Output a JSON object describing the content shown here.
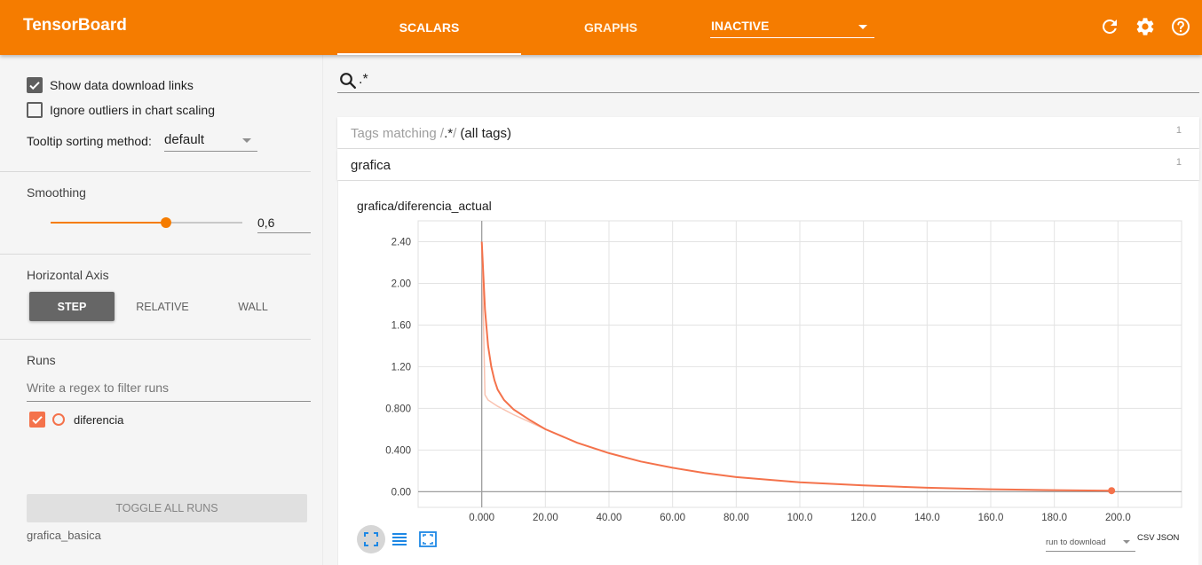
{
  "app": {
    "title": "TensorBoard"
  },
  "header": {
    "tabs": [
      {
        "label": "SCALARS",
        "active": true
      },
      {
        "label": "GRAPHS",
        "active": false
      }
    ],
    "inactive_select": "INACTIVE",
    "icons": [
      "refresh-icon",
      "settings-icon",
      "help-icon"
    ]
  },
  "sidebar": {
    "show_download_links": {
      "label": "Show data download links",
      "checked": true
    },
    "ignore_outliers": {
      "label": "Ignore outliers in chart scaling",
      "checked": false
    },
    "tooltip_sorting": {
      "label": "Tooltip sorting method:",
      "value": "default"
    },
    "smoothing": {
      "title": "Smoothing",
      "value": 0.6,
      "display": "0,6"
    },
    "horizontal_axis": {
      "title": "Horizontal Axis",
      "options": [
        "STEP",
        "RELATIVE",
        "WALL"
      ],
      "selected": "STEP"
    },
    "runs": {
      "title": "Runs",
      "filter_placeholder": "Write a regex to filter runs",
      "items": [
        {
          "name": "diferencia",
          "checked": true,
          "color": "#f4724b"
        }
      ]
    },
    "toggle_all_runs": "TOGGLE ALL RUNS",
    "logdir": "grafica_basica"
  },
  "main": {
    "search": {
      "value": ".*"
    },
    "tags_bar": {
      "prefix": "Tags matching /",
      "regex": ".*",
      "suffix": "/",
      "all_tags": "(all tags)",
      "count": "1"
    },
    "category": {
      "name": "grafica",
      "count": "1"
    },
    "card": {
      "title": "grafica/diferencia_actual",
      "download": {
        "select": "run to download",
        "csv": "CSV",
        "json": "JSON"
      }
    }
  },
  "colors": {
    "accent": "#f57c00",
    "series": "#f4724b",
    "series_raw": "#f9c3b1"
  },
  "chart_data": {
    "type": "line",
    "title": "grafica/diferencia_actual",
    "xlabel": "",
    "ylabel": "",
    "xlim": [
      -20,
      220
    ],
    "ylim": [
      -0.15,
      2.6
    ],
    "x_ticks": [
      "0.000",
      "20.00",
      "40.00",
      "60.00",
      "80.00",
      "100.0",
      "120.0",
      "140.0",
      "160.0",
      "180.0",
      "200.0"
    ],
    "y_ticks": [
      "0.00",
      "0.400",
      "0.800",
      "1.20",
      "1.60",
      "2.00",
      "2.40"
    ],
    "x_tick_values": [
      0,
      20,
      40,
      60,
      80,
      100,
      120,
      140,
      160,
      180,
      200
    ],
    "y_tick_values": [
      0,
      0.4,
      0.8,
      1.2,
      1.6,
      2.0,
      2.4
    ],
    "grid": true,
    "series": [
      {
        "name": "diferencia",
        "smoothed": [
          [
            0,
            2.4
          ],
          [
            1,
            1.75
          ],
          [
            2,
            1.4
          ],
          [
            3,
            1.2
          ],
          [
            4,
            1.07
          ],
          [
            5,
            0.98
          ],
          [
            7,
            0.88
          ],
          [
            10,
            0.79
          ],
          [
            15,
            0.69
          ],
          [
            20,
            0.6
          ],
          [
            30,
            0.47
          ],
          [
            40,
            0.37
          ],
          [
            50,
            0.29
          ],
          [
            60,
            0.23
          ],
          [
            70,
            0.18
          ],
          [
            80,
            0.14
          ],
          [
            100,
            0.09
          ],
          [
            120,
            0.06
          ],
          [
            140,
            0.038
          ],
          [
            160,
            0.024
          ],
          [
            180,
            0.015
          ],
          [
            198,
            0.01
          ]
        ],
        "raw": [
          [
            0,
            2.4
          ],
          [
            1,
            0.93
          ],
          [
            2,
            0.88
          ],
          [
            5,
            0.82
          ],
          [
            10,
            0.74
          ],
          [
            15,
            0.67
          ],
          [
            20,
            0.6
          ]
        ]
      }
    ],
    "last_point": [
      198,
      0.01
    ]
  }
}
